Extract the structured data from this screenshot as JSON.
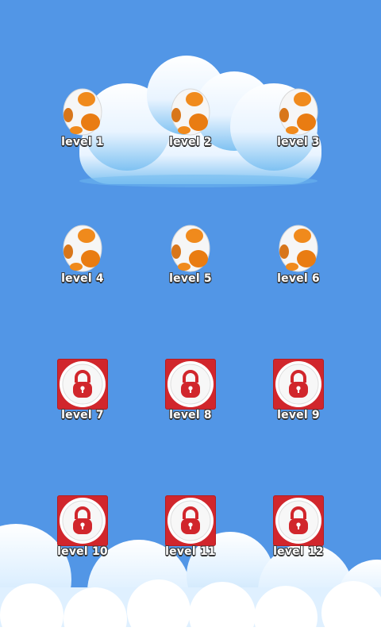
{
  "colors": {
    "sky": "#5296e6",
    "egg_spot": "#f08a1c",
    "lock_red": "#d1262c",
    "label_text": "#ffffff"
  },
  "levels": [
    {
      "label": "level 1",
      "state": "unlocked",
      "icon": "egg-icon"
    },
    {
      "label": "level 2",
      "state": "unlocked",
      "icon": "egg-icon"
    },
    {
      "label": "level 3",
      "state": "unlocked",
      "icon": "egg-icon"
    },
    {
      "label": "level 4",
      "state": "unlocked",
      "icon": "egg-icon"
    },
    {
      "label": "level 5",
      "state": "unlocked",
      "icon": "egg-icon"
    },
    {
      "label": "level 6",
      "state": "unlocked",
      "icon": "egg-icon"
    },
    {
      "label": "level 7",
      "state": "locked",
      "icon": "padlock-icon"
    },
    {
      "label": "level 8",
      "state": "locked",
      "icon": "padlock-icon"
    },
    {
      "label": "level 9",
      "state": "locked",
      "icon": "padlock-icon"
    },
    {
      "label": "level 10",
      "state": "locked",
      "icon": "padlock-icon"
    },
    {
      "label": "level 11",
      "state": "locked",
      "icon": "padlock-icon"
    },
    {
      "label": "level 12",
      "state": "locked",
      "icon": "padlock-icon"
    }
  ]
}
